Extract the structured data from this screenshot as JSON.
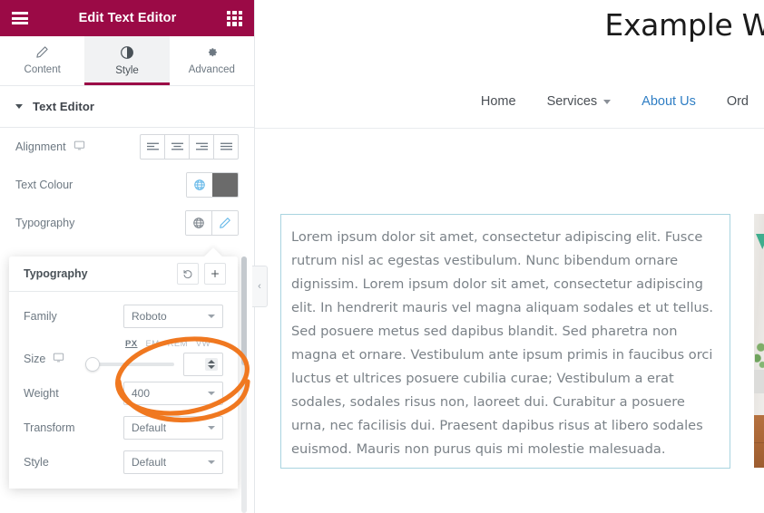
{
  "panel": {
    "header": {
      "title": "Edit Text Editor",
      "menu_icon": "hamburger-icon",
      "apps_icon": "grid-apps-icon",
      "bg_color": "#9b0a46"
    },
    "tabs": [
      {
        "label": "Content",
        "icon": "pencil-icon",
        "active": false
      },
      {
        "label": "Style",
        "icon": "contrast-icon",
        "active": true
      },
      {
        "label": "Advanced",
        "icon": "gear-icon",
        "active": false
      }
    ],
    "section": {
      "title": "Text Editor",
      "collapse_icon": "caret-down-icon"
    },
    "controls": [
      {
        "label": "Alignment",
        "device_icon": "desktop-monitor-icon",
        "type": "alignment",
        "options": [
          "align-left",
          "align-center",
          "align-right",
          "align-justify"
        ]
      },
      {
        "label": "Text Colour",
        "type": "color",
        "globe_icon": "globe-icon",
        "swatch_color": "#6b6b6b"
      },
      {
        "label": "Typography",
        "type": "typography",
        "globe_icon": "globe-icon",
        "edit_icon": "pencil-edit-icon"
      }
    ]
  },
  "typography_popover": {
    "title": "Typography",
    "reset_icon": "reset-undo-icon",
    "add_icon": "plus-icon",
    "fields": {
      "family": {
        "label": "Family",
        "value": "Roboto"
      },
      "size": {
        "label": "Size",
        "device_icon": "desktop-monitor-icon",
        "units": [
          "PX",
          "EM",
          "REM",
          "VW"
        ],
        "active_unit": "PX",
        "value": "",
        "slider_percent": 0
      },
      "weight": {
        "label": "Weight",
        "value": "400"
      },
      "transform": {
        "label": "Transform",
        "value": "Default"
      },
      "style": {
        "label": "Style",
        "value": "Default"
      }
    }
  },
  "annotation": {
    "shape": "ellipse-highlight",
    "color": "#f07820",
    "target": "size-unit-and-value-input"
  },
  "canvas": {
    "site_title": "Example W",
    "nav": [
      {
        "label": "Home",
        "current": false,
        "has_dropdown": false
      },
      {
        "label": "Services",
        "current": false,
        "has_dropdown": true
      },
      {
        "label": "About Us",
        "current": true,
        "has_dropdown": false
      },
      {
        "label": "Ord",
        "current": false,
        "has_dropdown": false
      }
    ],
    "nav_current_color": "#2f7ec4",
    "text_widget": {
      "selected_border_color": "#a9d4e0",
      "content": "Lorem ipsum dolor sit amet, consectetur adipiscing elit. Fusce rutrum nisl ac egestas vestibulum. Nunc bibendum ornare dignissim. Lorem ipsum dolor sit amet, consectetur adipiscing elit. In hendrerit mauris vel magna aliquam sodales et ut tellus. Sed posuere metus sed dapibus blandit. Sed pharetra non magna et ornare. Vestibulum ante ipsum primis in faucibus orci luctus et ultrices posuere cubilia curae; Vestibulum a erat sodales, sodales risus non, laoreet dui. Curabitur a posuere urna, nec facilisis dui. Praesent dapibus risus at libero sodales euismod. Mauris non purus quis mi molestie malesuada."
    },
    "side_image": {
      "alt": "interior plant photo"
    },
    "collapse_handle": {
      "icon": "chevron-left-icon"
    }
  }
}
